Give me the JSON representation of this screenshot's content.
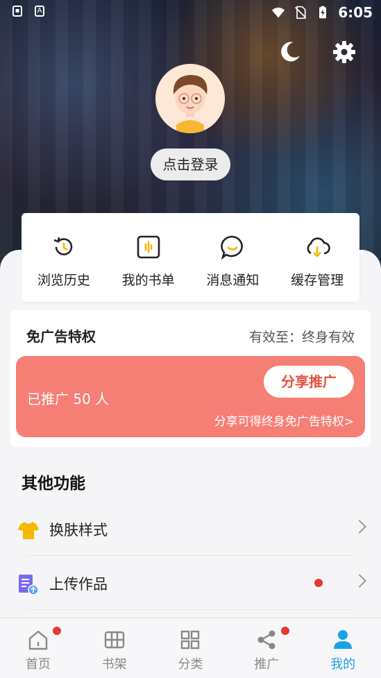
{
  "status_bar": {
    "time": "6:05",
    "left_icons": [
      "lock-icon",
      "a-icon"
    ],
    "right_icons": [
      "wifi-icon",
      "no-sim-icon",
      "battery-charging-icon"
    ]
  },
  "header": {
    "login_label": "点击登录",
    "icons": [
      "moon-icon",
      "gear-icon"
    ]
  },
  "quick_actions": [
    {
      "label": "浏览历史",
      "icon": "history-icon"
    },
    {
      "label": "我的书单",
      "icon": "booklist-icon"
    },
    {
      "label": "消息通知",
      "icon": "message-icon"
    },
    {
      "label": "缓存管理",
      "icon": "cloud-download-icon"
    }
  ],
  "ad_privilege": {
    "title": "免广告特权",
    "validity": "有效至：终身有效",
    "promoted_count": "已推广 50 人",
    "share_button": "分享推广",
    "share_hint": "分享可得终身免广告特权>"
  },
  "other_functions": {
    "title": "其他功能",
    "items": [
      {
        "label": "换肤样式",
        "icon": "tshirt-icon",
        "badge": false
      },
      {
        "label": "上传作品",
        "icon": "upload-doc-icon",
        "badge": true
      }
    ]
  },
  "bottom_nav": [
    {
      "label": "首页",
      "icon": "home-icon",
      "badge": true,
      "active": false
    },
    {
      "label": "书架",
      "icon": "bookshelf-icon",
      "badge": false,
      "active": false
    },
    {
      "label": "分类",
      "icon": "grid-icon",
      "badge": false,
      "active": false
    },
    {
      "label": "推广",
      "icon": "share-icon",
      "badge": true,
      "active": false
    },
    {
      "label": "我的",
      "icon": "user-icon",
      "badge": false,
      "active": true
    }
  ],
  "colors": {
    "accent": "#1aa3e8",
    "promo": "#f57f75",
    "badge": "#e53935",
    "icon_yellow": "#f5b700"
  }
}
